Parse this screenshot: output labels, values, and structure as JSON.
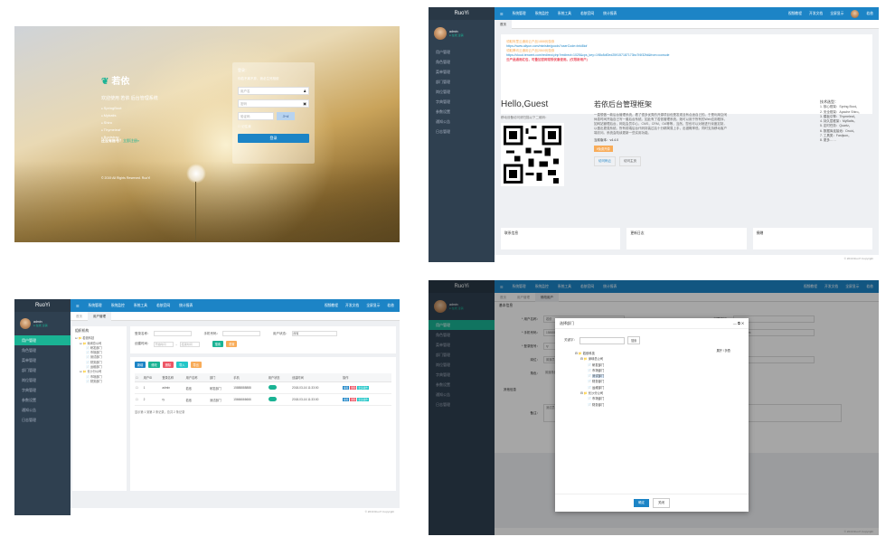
{
  "login": {
    "brand": "若依",
    "welcome": "欢迎使用 若依 后台管理系统",
    "features": [
      "SpringBoot",
      "Mybatis",
      "Shiro",
      "Thymeleaf",
      "Bootstrap"
    ],
    "register_prefix": "还没有账号？",
    "register_link": "立即注册»",
    "copyright": "© 2019 All Rights Reserved. RuoYi",
    "form_title": "登录：",
    "form_subtitle": "你若不离不弃，我必生死相依",
    "username_placeholder": "用户名",
    "password_placeholder": "密码",
    "captcha_placeholder": "验证码",
    "captcha_text": "3+4",
    "remember": "记住我",
    "submit": "登录"
  },
  "app": {
    "brand": "RuoYi",
    "user_name": "admin",
    "user_status": "● 在线",
    "user_action": "注销",
    "menu": [
      "用户管理",
      "角色管理",
      "菜单管理",
      "部门管理",
      "岗位管理",
      "字典管理",
      "参数设置",
      "通知公告",
      "日志管理"
    ],
    "top_menu": [
      "☰",
      "系统管理",
      "系统监控",
      "系统工具",
      "若依官网",
      "统计报表"
    ],
    "top_right": [
      "视频教程",
      "开发文档",
      "全屏显示",
      "若依"
    ],
    "footer": "© 2019 RuoYi Copyright"
  },
  "home": {
    "tab": "首页",
    "links": [
      {
        "text": "领取阿里云通用云产品1888优惠券",
        "style": "o"
      },
      {
        "text": "https://www.aliyun.com/minisite/goods?userCode=brki8iof",
        "style": "b"
      },
      {
        "text": "领取腾讯云通用云产品2860优惠券",
        "style": "o"
      },
      {
        "text": "https://cloud.tencent.com/redirect.php?redirect=1025&cps_key=198c8df2ed259157187173bc7f4f32fd&from=console",
        "style": "b"
      },
      {
        "text": "云产品通用红包，可叠加官网常规优惠使用。(仅限新用户)",
        "style": "r"
      }
    ],
    "hello": "Hello,Guest",
    "scan_text": "移动设备访问请扫描以下二维码：",
    "title": "若依后台管理框架",
    "intro": "一直想做一款后台管理系统，看了很多优秀的开源项目但是发现没有合适自己的。于是利用空闲休息时间开始自己写一套后台系统。如此有了若依管理系统。她可以用于所有的Web应用程序，如网站管理后台，网站会员中心，CMS，CRM，OA等等，当然，您也可以对她进行深度定制，以做出更强系统。所有前端后台代码封装过后十分精简易上手，出错概率低。同时支持移动客户端访问。系统会陆续更新一些实用功能。",
    "version": "当前版本：v4.4.0",
    "free": "¥免费开源",
    "btn_visit": "访问码云",
    "btn_home": "访问主页",
    "stack_title": "技术选型：",
    "stack": [
      "1. 核心框架：Spring Boot。",
      "2. 安全框架：Apache Shiro。",
      "3. 模板引擎：Thymeleaf。",
      "4. 持久层框架：MyBatis。",
      "5. 定时任务：Quartz。",
      "6. 数据库连接池：Druid。",
      "7. 工具类：Fastjson。",
      "8. 更多……"
    ],
    "cards": [
      "联系信息",
      "更新日志",
      "捐赠"
    ]
  },
  "users": {
    "tab_home": "首页",
    "tab": "用户管理",
    "tree_title": "组织机构",
    "tree": [
      "若依科技",
      "深圳总公司",
      "研发部门",
      "市场部门",
      "测试部门",
      "财务部门",
      "运维部门",
      "长沙分公司",
      "市场部门",
      "财务部门"
    ],
    "labels": {
      "login": "登录名称：",
      "phone": "手机号码：",
      "status": "用户状态：",
      "created": "创建时间："
    },
    "status_value": "所有",
    "date_start": "开始时间",
    "date_end": "结束时间",
    "search": "搜索",
    "reset": "重置",
    "toolbar": [
      "新增",
      "修改",
      "删除",
      "导入",
      "导出"
    ],
    "columns": [
      "",
      "用户ID",
      "登录名称",
      "用户名称",
      "部门",
      "手机",
      "用户状态",
      "创建时间",
      "操作"
    ],
    "rows": [
      {
        "id": "1",
        "login": "admin",
        "name": "若依",
        "dept": "研发部门",
        "phone": "15888888888",
        "time": "2018-03-16 11:33:00"
      },
      {
        "id": "2",
        "login": "ry",
        "name": "若依",
        "dept": "测试部门",
        "phone": "15666666666",
        "time": "2018-03-16 11:33:00"
      }
    ],
    "ops": [
      "编辑",
      "删除",
      "更多操作"
    ],
    "pager": "显示第 1 到第 2 条记录，总共 2 条记录"
  },
  "edit": {
    "tab": "修改用户",
    "section_basic": "基本信息",
    "section_other": "其他信息",
    "fields": [
      {
        "label": "* 用户名称：",
        "value": "若依"
      },
      {
        "label": "* 手机号码：",
        "value": "15888888888"
      },
      {
        "label": "* 登录账号：",
        "value": "ry"
      },
      {
        "label": "岗位：",
        "value": "普通员工"
      },
      {
        "label": "角色：",
        "value": "普通角色"
      }
    ],
    "right_fields": [
      {
        "label": "归属部门：",
        "value": ""
      },
      {
        "label": "邮箱：",
        "value": "ry@qq.com"
      },
      {
        "label": "用户状态：",
        "value": ""
      },
      {
        "label": "用户性别：",
        "value": "女"
      }
    ],
    "remark_label": "备注：",
    "remark_value": "测试员"
  },
  "modal": {
    "title": "选择部门",
    "keyword_label": "关键字：",
    "search": "搜索",
    "expand": "展开 / 折叠",
    "tree": [
      "若依科技",
      "深圳总公司",
      "研发部门",
      "市场部门",
      "测试部门",
      "财务部门",
      "运维部门",
      "长沙分公司",
      "市场部门",
      "财务部门"
    ],
    "ok": "确定",
    "close": "关闭"
  }
}
